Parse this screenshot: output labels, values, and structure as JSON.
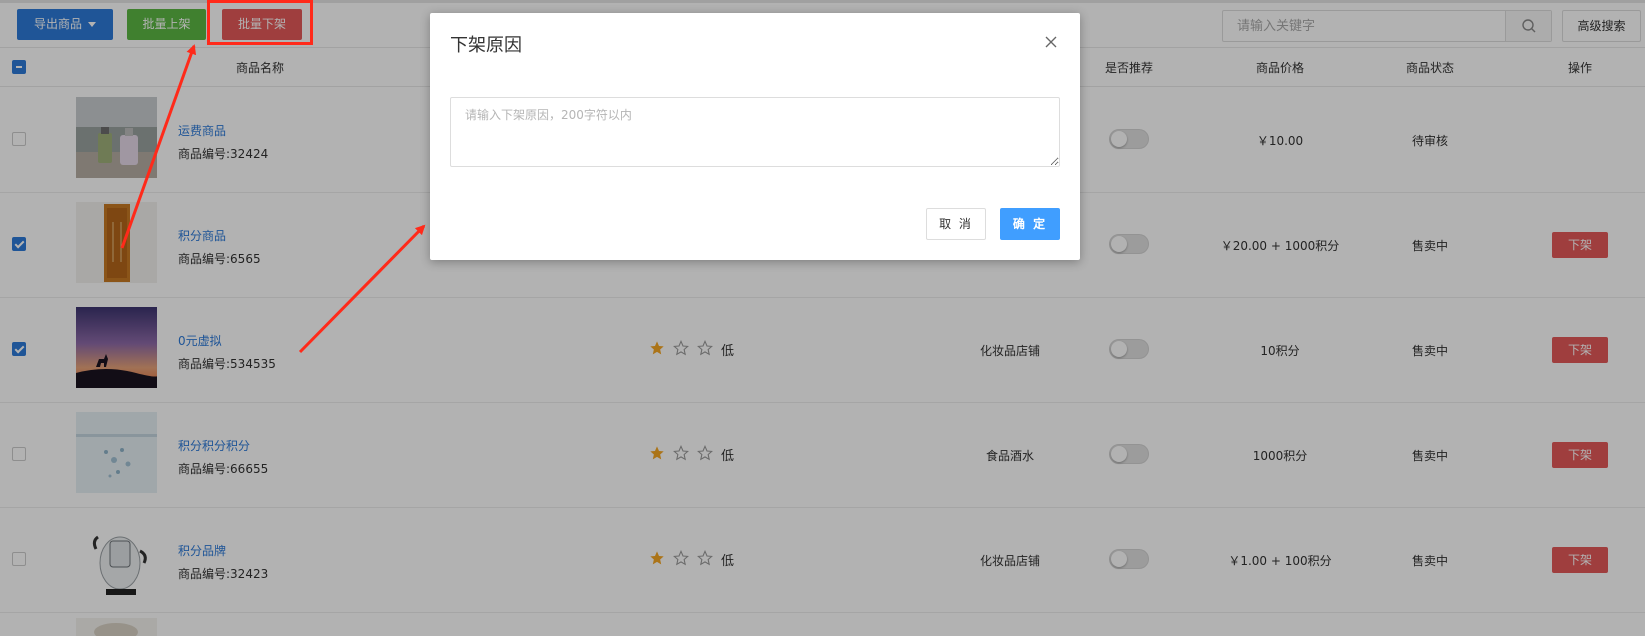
{
  "toolbar": {
    "export_label": "导出商品",
    "batch_up_label": "批量上架",
    "batch_down_label": "批量下架",
    "search_placeholder": "请输入关键字",
    "advanced_search_label": "高级搜索"
  },
  "table": {
    "headers": {
      "name": "商品名称",
      "recommend": "是否推荐",
      "price": "商品价格",
      "status": "商品状态",
      "action": "操作"
    },
    "rows": [
      {
        "name": "运费商品",
        "code": "商品编号:32424",
        "stars": 0,
        "level": "",
        "store": "",
        "price": "￥10.00",
        "status": "待审核",
        "action": "",
        "checked": false
      },
      {
        "name": "积分商品",
        "code": "商品编号:6565",
        "stars": 0,
        "level": "",
        "store": "",
        "price": "￥20.00 + 1000积分",
        "status": "售卖中",
        "action": "下架",
        "checked": true
      },
      {
        "name": "0元虚拟",
        "code": "商品编号:534535",
        "stars": 1,
        "level": "低",
        "store": "化妆品店铺",
        "price": "10积分",
        "status": "售卖中",
        "action": "下架",
        "checked": true
      },
      {
        "name": "积分积分积分",
        "code": "商品编号:66655",
        "stars": 1,
        "level": "低",
        "store": "食品酒水",
        "price": "1000积分",
        "status": "售卖中",
        "action": "下架",
        "checked": false
      },
      {
        "name": "积分品牌",
        "code": "商品编号:32423",
        "stars": 1,
        "level": "低",
        "store": "化妆品店铺",
        "price": "￥1.00 + 100积分",
        "status": "售卖中",
        "action": "下架",
        "checked": false
      }
    ]
  },
  "modal": {
    "title": "下架原因",
    "textarea_placeholder": "请输入下架原因，200字符以内",
    "cancel_label": "取 消",
    "ok_label": "确 定"
  },
  "colors": {
    "primary": "#2d7ad8",
    "success": "#5cb844",
    "danger": "#e45a5a",
    "modal_ok": "#409eff",
    "annotation": "#ff2a1a",
    "star": "#f5a623"
  }
}
